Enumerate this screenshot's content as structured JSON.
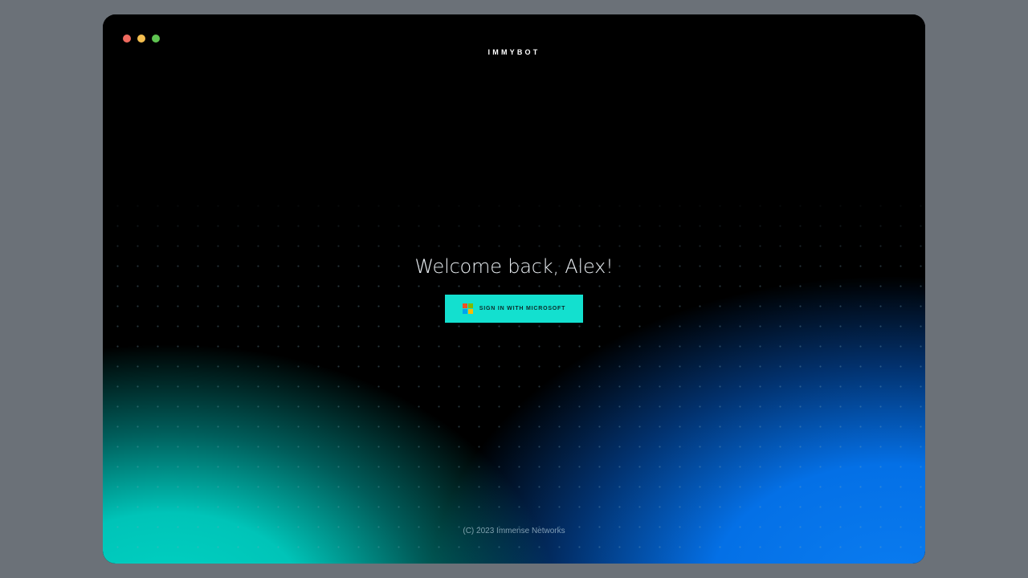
{
  "app": {
    "brand": "IMMYBOT"
  },
  "window_controls": {
    "close_icon": "red-dot",
    "minimize_icon": "yellow-dot",
    "maximize_icon": "green-dot"
  },
  "main": {
    "welcome": "Welcome back, Alex!",
    "signin_button": {
      "label": "SIGN IN WITH MICROSOFT",
      "icon": "microsoft-logo-icon"
    }
  },
  "footer": {
    "copyright": "(C) 2023 Immense Networks"
  },
  "colors": {
    "accent": "#13e0cf",
    "background": "#000000",
    "glow_left": "#00c4b8",
    "glow_right": "#0470e6",
    "outer": "#6b7178"
  }
}
